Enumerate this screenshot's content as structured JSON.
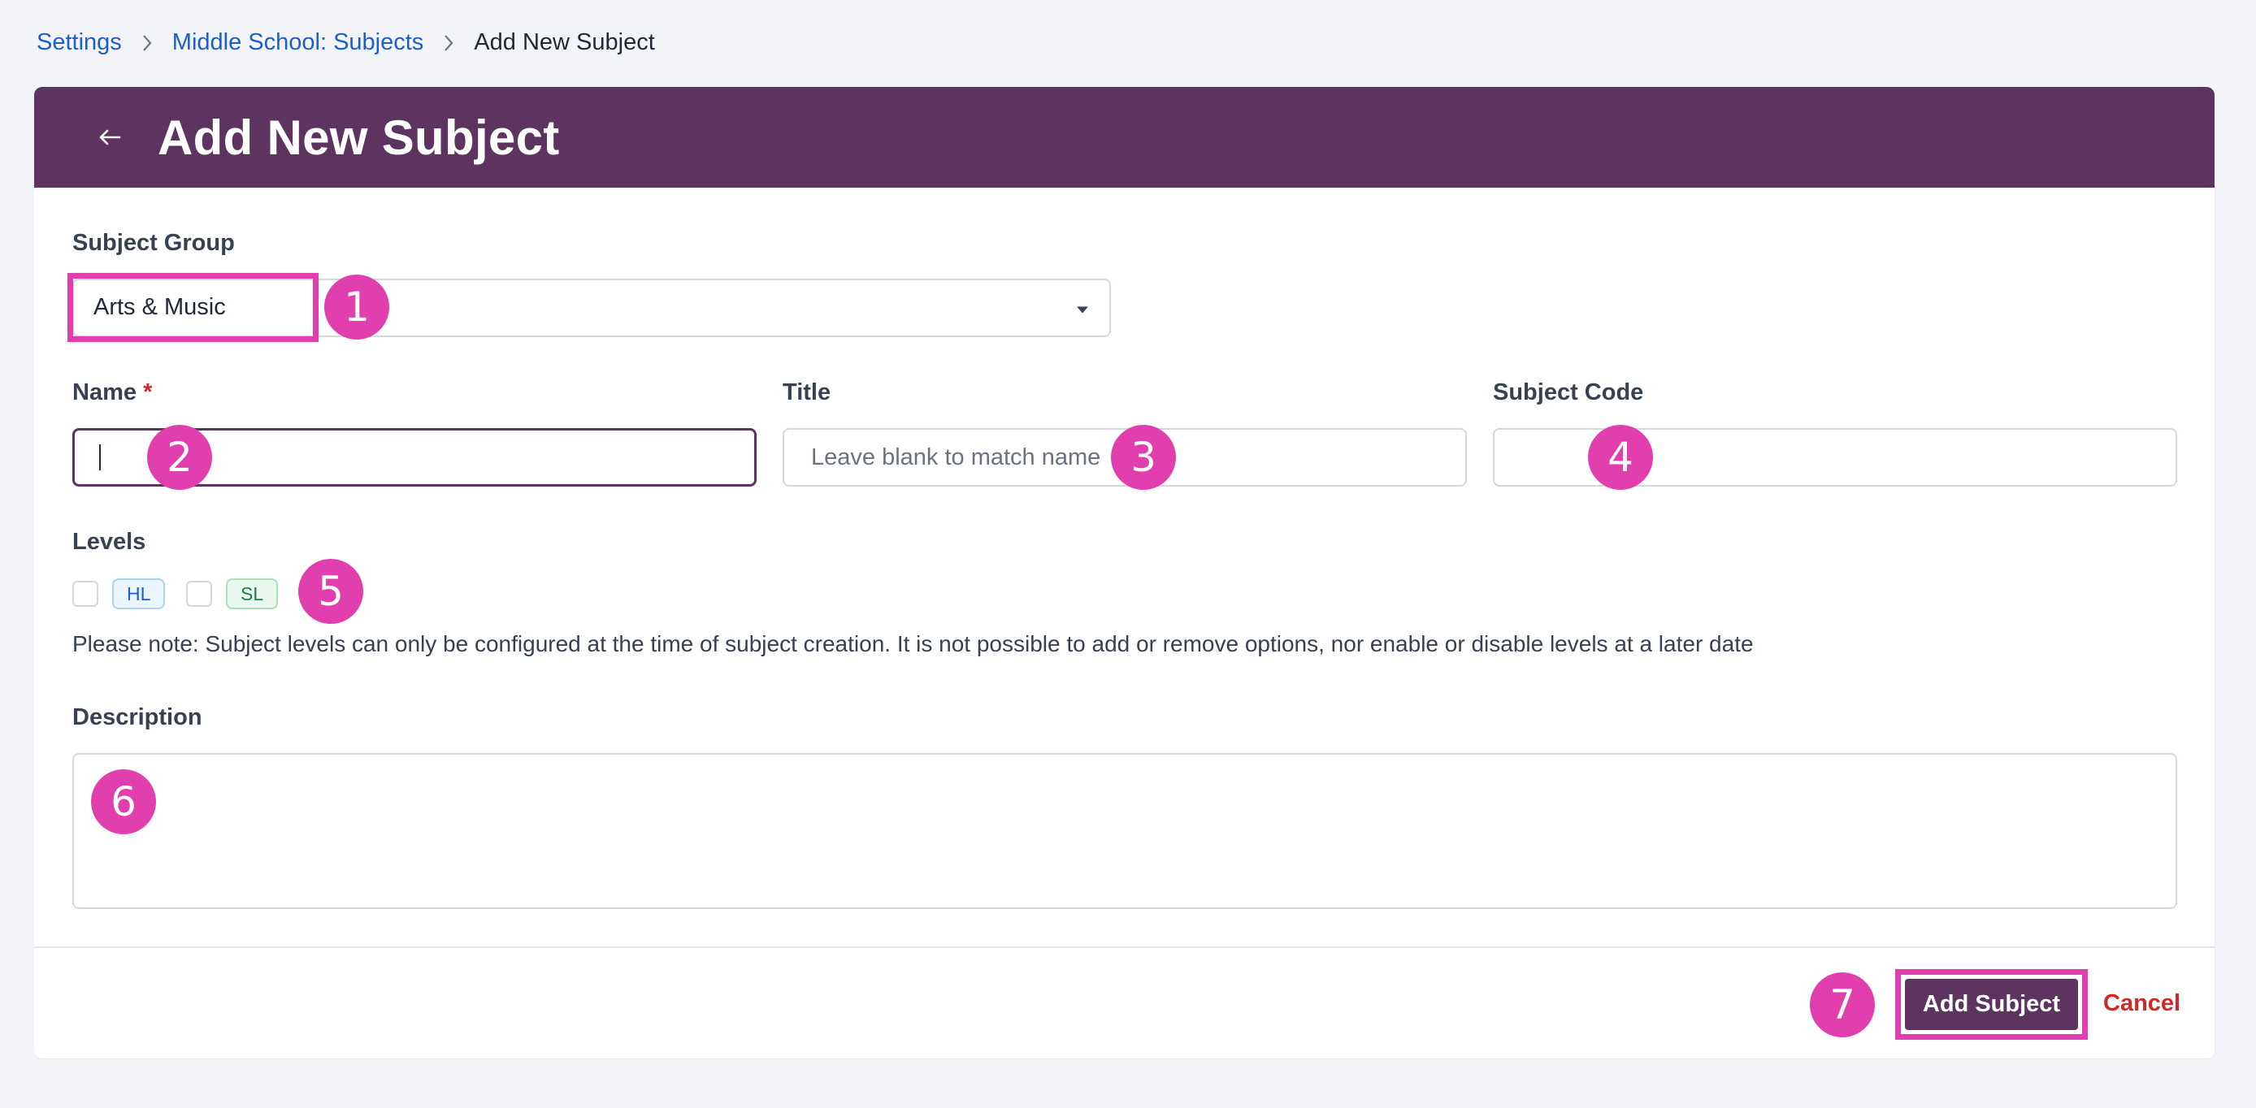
{
  "breadcrumb": {
    "items": [
      "Settings",
      "Middle School: Subjects"
    ],
    "current": "Add New Subject"
  },
  "header": {
    "title": "Add New Subject",
    "back_icon": "arrow-left-icon"
  },
  "form": {
    "subject_group": {
      "label": "Subject Group",
      "value": "Arts & Music"
    },
    "name": {
      "label": "Name",
      "required_mark": "*",
      "value": ""
    },
    "title": {
      "label": "Title",
      "placeholder": "Leave blank to match name"
    },
    "subject_code": {
      "label": "Subject Code",
      "value": ""
    },
    "levels": {
      "label": "Levels",
      "options": [
        {
          "label": "HL",
          "checked": false
        },
        {
          "label": "SL",
          "checked": false
        }
      ],
      "note": "Please note: Subject levels can only be configured at the time of subject creation. It is not possible to add or remove options, nor enable or disable levels at a later date"
    },
    "description": {
      "label": "Description",
      "value": ""
    }
  },
  "actions": {
    "submit_label": "Add Subject",
    "cancel_label": "Cancel"
  },
  "annotations": [
    "1",
    "2",
    "3",
    "4",
    "5",
    "6",
    "7"
  ],
  "colors": {
    "header_bg": "#5d3360",
    "link": "#1d5fc9",
    "annotation": "#e23fae",
    "danger": "#d42828"
  }
}
